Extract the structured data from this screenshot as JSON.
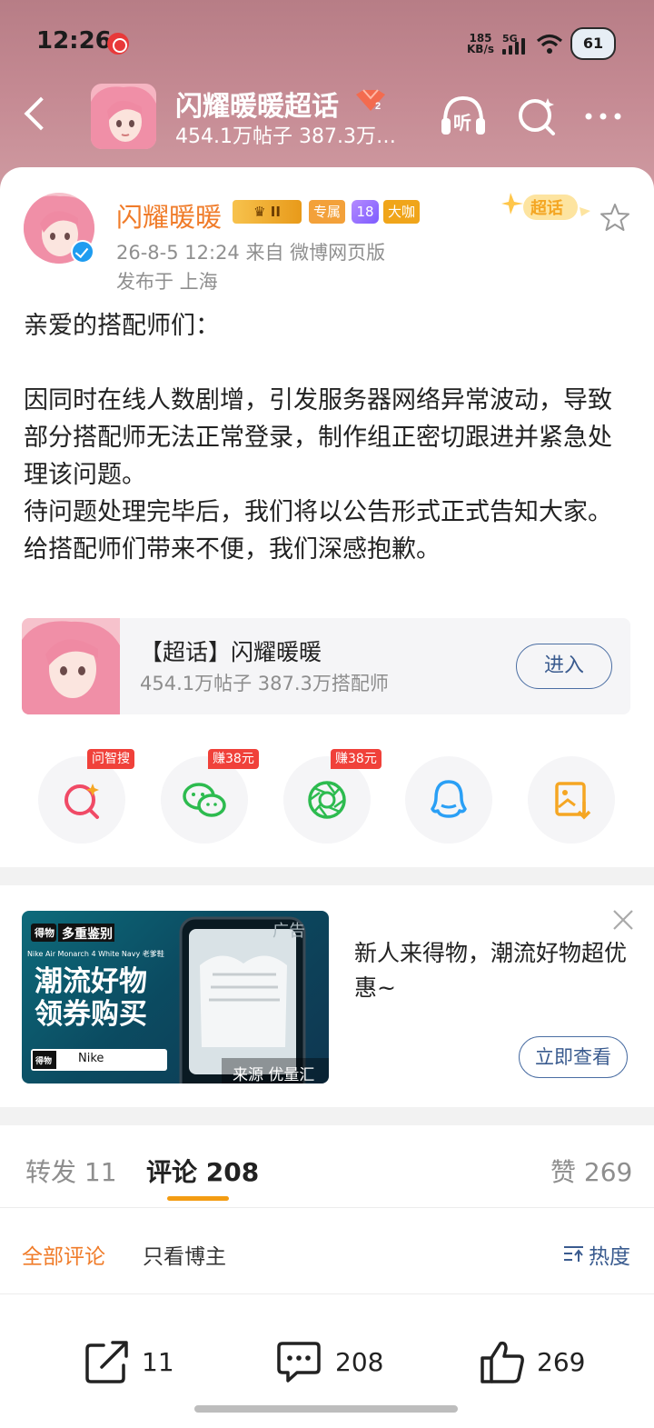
{
  "status_bar": {
    "time": "12:26",
    "net_speed_value": "185",
    "net_speed_unit": "KB/s",
    "network": "5G",
    "battery": "61"
  },
  "nav": {
    "title": "闪耀暖暖超话",
    "subtitle": "454.1万帖子 387.3万…",
    "level_badge": "2",
    "listen_label": "听"
  },
  "post": {
    "author": "闪耀暖暖",
    "badges": {
      "crown": "II",
      "exclusive": "专属",
      "diamond": "18",
      "big_shot": "大咖"
    },
    "chaohua_tag": "超话",
    "meta": "26-8-5 12:24  来自 微博网页版",
    "location": "发布于 上海",
    "body": [
      "亲爱的搭配师们：",
      "",
      "因同时在线人数剧增，引发服务器网络异常波动，导致部分搭配师无法正常登录，制作组正密切跟进并紧急处理该问题。",
      "待问题处理完毕后，我们将以公告形式正式告知大家。",
      "给搭配师们带来不便，我们深感抱歉。"
    ]
  },
  "topic_card": {
    "title": "【超话】闪耀暖暖",
    "subtitle": "454.1万帖子 387.3万搭配师",
    "enter_label": "进入"
  },
  "share": {
    "tags": [
      "问智搜",
      "赚38元",
      "赚38元"
    ]
  },
  "ad": {
    "label": "广告",
    "brand_tag": "多重鉴别",
    "product": "Nike Air Monarch 4 White Navy 老爹鞋",
    "slogan_1": "潮流好物",
    "slogan_2": "领券购买",
    "search_text": "Nike",
    "source": "来源 优量汇",
    "text": "新人来得物，潮流好物超优惠~",
    "button": "立即查看"
  },
  "tabs": {
    "repost": "转发 11",
    "comments": "评论 208",
    "likes": "赞 269"
  },
  "filter": {
    "all": "全部评论",
    "author_only": "只看博主",
    "sort": "热度"
  },
  "bottom_bar": {
    "repost_count": "11",
    "comment_count": "208",
    "like_count": "269"
  },
  "colors": {
    "accent_orange": "#f07c2a",
    "link_blue": "#3a5b8f",
    "tag_red": "#f0413a"
  }
}
